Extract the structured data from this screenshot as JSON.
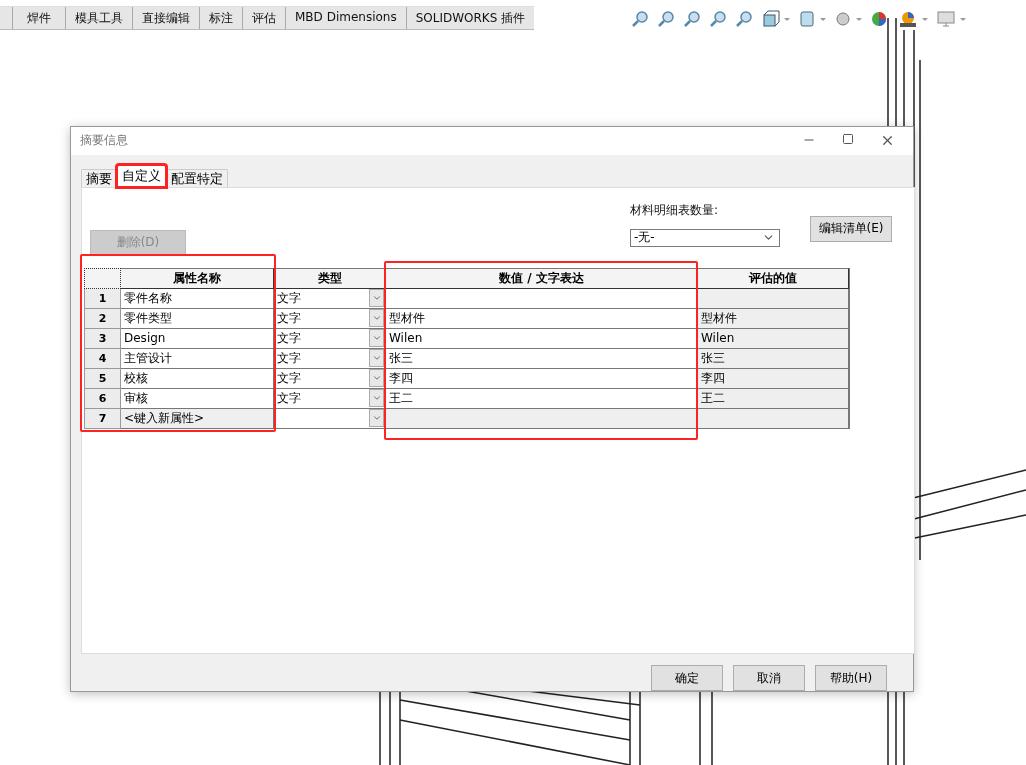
{
  "command_tabs": [
    {
      "label": "焊件"
    },
    {
      "label": "模具工具"
    },
    {
      "label": "直接编辑"
    },
    {
      "label": "标注"
    },
    {
      "label": "评估"
    },
    {
      "label": "MBD Dimensions"
    },
    {
      "label": "SOLIDWORKS 插件"
    }
  ],
  "dialog": {
    "title": "摘要信息",
    "tabs": [
      {
        "label": "摘要",
        "selected": false
      },
      {
        "label": "自定义",
        "selected": true
      },
      {
        "label": "配置特定",
        "selected": false
      }
    ],
    "delete_button": {
      "label": "删除(D)",
      "disabled": true
    },
    "bom_quantity": {
      "label": "材料明细表数量:",
      "value": "-无-"
    },
    "edit_list_button": {
      "label": "编辑清单(E)",
      "disabled": false
    },
    "table": {
      "columns": [
        "属性名称",
        "类型",
        "数值 / 文字表达",
        "评估的值"
      ],
      "rows": [
        {
          "number": "1",
          "kind": "property",
          "name": "零件名称",
          "type": "文字",
          "value": "",
          "evaluated": ""
        },
        {
          "number": "2",
          "kind": "property",
          "name": "零件类型",
          "type": "文字",
          "value": "型材件",
          "evaluated": "型材件"
        },
        {
          "number": "3",
          "kind": "property",
          "name": "Design",
          "type": "文字",
          "value": "Wilen",
          "evaluated": "Wilen"
        },
        {
          "number": "4",
          "kind": "property",
          "name": "主管设计",
          "type": "文字",
          "value": "张三",
          "evaluated": "张三"
        },
        {
          "number": "5",
          "kind": "property",
          "name": "校核",
          "type": "文字",
          "value": "李四",
          "evaluated": "李四"
        },
        {
          "number": "6",
          "kind": "property",
          "name": "审核",
          "type": "文字",
          "value": "王二",
          "evaluated": "王二"
        },
        {
          "number": "7",
          "kind": "new",
          "name": "<键入新属性>",
          "type": "",
          "value": "",
          "evaluated": ""
        }
      ]
    },
    "buttons": [
      "确定",
      "取消",
      "帮助(H)"
    ]
  }
}
